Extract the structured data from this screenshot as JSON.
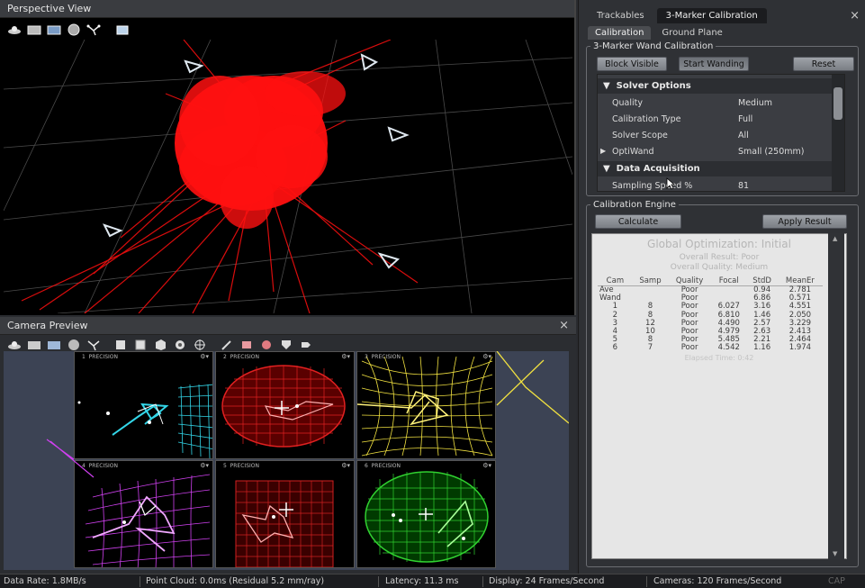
{
  "perspective": {
    "title": "Perspective View",
    "toolbar_icons": [
      "camera-view-icon",
      "screen-icon",
      "image-icon",
      "sphere-icon",
      "connect-icon",
      "frame-icon"
    ]
  },
  "camera_preview": {
    "title": "Camera Preview",
    "close": "×",
    "toolbar_icons": [
      "camera-view-icon",
      "screen-icon",
      "image-icon",
      "circle-icon",
      "connect-icon",
      "box-icon",
      "square-icon",
      "cube-icon",
      "gear-icon",
      "crosshair-icon",
      "pen-icon",
      "mask-icon",
      "blob-icon",
      "shield-icon",
      "tag-icon"
    ],
    "cameras": [
      {
        "num": "1",
        "label": "PRECISION",
        "menu": "⚙▾",
        "color": "#33d6e8"
      },
      {
        "num": "2",
        "label": "PRECISION",
        "menu": "⚙▾",
        "color": "#e02020"
      },
      {
        "num": "3",
        "label": "PRECISION",
        "menu": "⚙▾",
        "color": "#f0e040"
      },
      {
        "num": "4",
        "label": "PRECISION",
        "menu": "⚙▾",
        "color": "#d040f0"
      },
      {
        "num": "5",
        "label": "PRECISION",
        "menu": "⚙▾",
        "color": "#d02020"
      },
      {
        "num": "6",
        "label": "PRECISION",
        "menu": "⚙▾",
        "color": "#30d030"
      }
    ]
  },
  "right": {
    "tabs": [
      "Trackables",
      "3-Marker Calibration"
    ],
    "close": "×",
    "subtabs": [
      "Calibration",
      "Ground Plane"
    ],
    "wand_group": "3-Marker Wand Calibration",
    "buttons": {
      "block_visible": "Block Visible",
      "start_wanding": "Start Wanding",
      "reset": "Reset"
    },
    "solver_header": "Solver Options",
    "solver_rows": [
      {
        "key": "Quality",
        "value": "Medium"
      },
      {
        "key": "Calibration Type",
        "value": "Full"
      },
      {
        "key": "Solver Scope",
        "value": "All"
      },
      {
        "key": "OptiWand",
        "value": "Small (250mm)"
      }
    ],
    "acq_header": "Data Acquisition",
    "acq_rows": [
      {
        "key": "Sampling Speed %",
        "value": "81"
      }
    ],
    "engine_group": "Calibration Engine",
    "engine_buttons": {
      "calculate": "Calculate",
      "apply": "Apply Result"
    },
    "results": {
      "title": "Global Optimization: Initial",
      "overall_result": "Overall Result: Poor",
      "overall_quality": "Overall Quality: Medium",
      "columns": [
        "Cam",
        "Samp",
        "Quality",
        "Focal",
        "StdD",
        "MeanEr"
      ],
      "rows": [
        [
          "Ave",
          "",
          "Poor",
          "",
          "0.94",
          "2.781"
        ],
        [
          "Wand",
          "",
          "Poor",
          "",
          "6.86",
          "0.571"
        ],
        [
          "1",
          "8",
          "Poor",
          "6.027",
          "3.16",
          "4.551"
        ],
        [
          "2",
          "8",
          "Poor",
          "6.810",
          "1.46",
          "2.050"
        ],
        [
          "3",
          "12",
          "Poor",
          "4.490",
          "2.57",
          "3.229"
        ],
        [
          "4",
          "10",
          "Poor",
          "4.979",
          "2.63",
          "2.413"
        ],
        [
          "5",
          "8",
          "Poor",
          "5.485",
          "2.21",
          "2.464"
        ],
        [
          "6",
          "7",
          "Poor",
          "4.542",
          "1.16",
          "1.974"
        ]
      ],
      "elapsed": "Elapsed Time: 0:42"
    }
  },
  "status": {
    "data_rate": "Data Rate: 1.8MB/s",
    "point_cloud": "Point Cloud: 0.0ms (Residual 5.2 mm/ray)",
    "latency": "Latency: 11.3 ms",
    "display": "Display: 24 Frames/Second",
    "cameras": "Cameras: 120 Frames/Second",
    "cap": "CAP"
  }
}
